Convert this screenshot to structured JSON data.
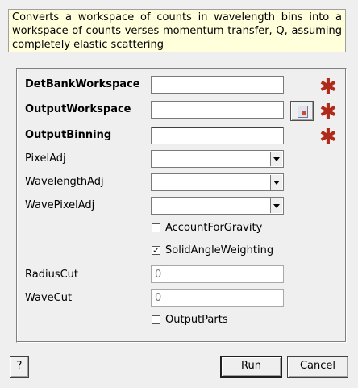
{
  "description": "Converts a workspace of counts in wavelength bins into a workspace of counts verses momentum transfer, Q, assuming completely elastic scattering",
  "fields": {
    "det_bank_workspace": {
      "label": "DetBankWorkspace",
      "value": ""
    },
    "output_workspace": {
      "label": "OutputWorkspace",
      "value": ""
    },
    "output_binning": {
      "label": "OutputBinning",
      "value": ""
    },
    "pixel_adj": {
      "label": "PixelAdj",
      "selected": ""
    },
    "wavelength_adj": {
      "label": "WavelengthAdj",
      "selected": ""
    },
    "wave_pixel_adj": {
      "label": "WavePixelAdj",
      "selected": ""
    },
    "account_for_gravity": {
      "label": "AccountForGravity",
      "checked": false
    },
    "solid_angle_weighting": {
      "label": "SolidAngleWeighting",
      "checked": true,
      "mark": "✓"
    },
    "radius_cut": {
      "label": "RadiusCut",
      "placeholder": "0"
    },
    "wave_cut": {
      "label": "WaveCut",
      "placeholder": "0"
    },
    "output_parts": {
      "label": "OutputParts",
      "checked": false
    }
  },
  "required_mark": "✱",
  "buttons": {
    "help": "?",
    "run": "Run",
    "cancel": "Cancel"
  },
  "colors": {
    "required": "#b02a1a",
    "description_bg": "#ffffdc",
    "dialog_bg": "#efefef"
  }
}
